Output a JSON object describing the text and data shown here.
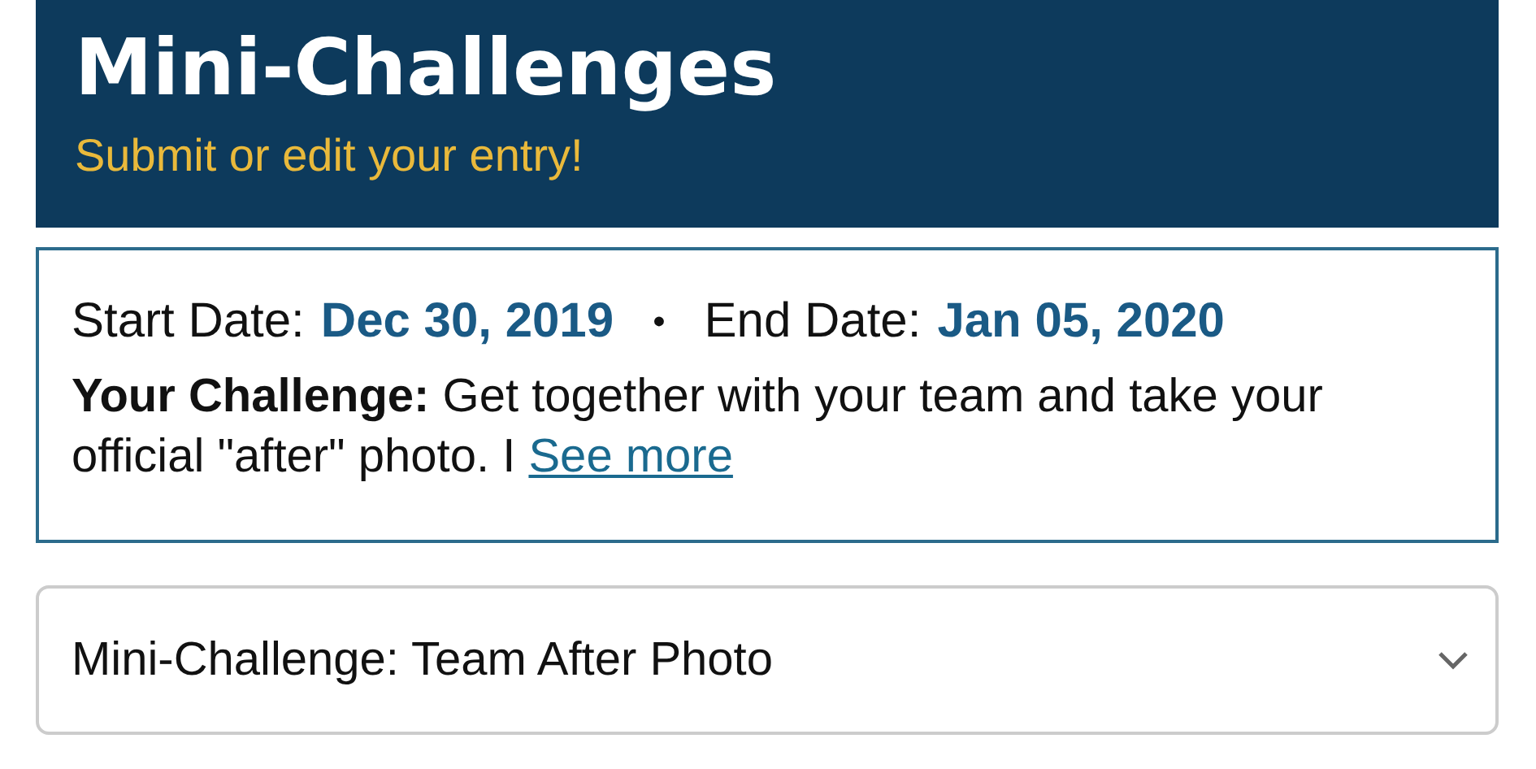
{
  "header": {
    "title": "Mini-Challenges",
    "subtitle": "Submit or edit your entry!"
  },
  "challenge": {
    "start_label": "Start Date:",
    "start_date": "Dec 30, 2019",
    "separator": "•",
    "end_label": "End Date:",
    "end_date": "Jan 05, 2020",
    "description": "**Your Challenge:** Get together with your team and take your official \"after\" photo. I",
    "link": "See more"
  },
  "dropdown": {
    "value": "Mini-Challenge: Team After Photo"
  }
}
